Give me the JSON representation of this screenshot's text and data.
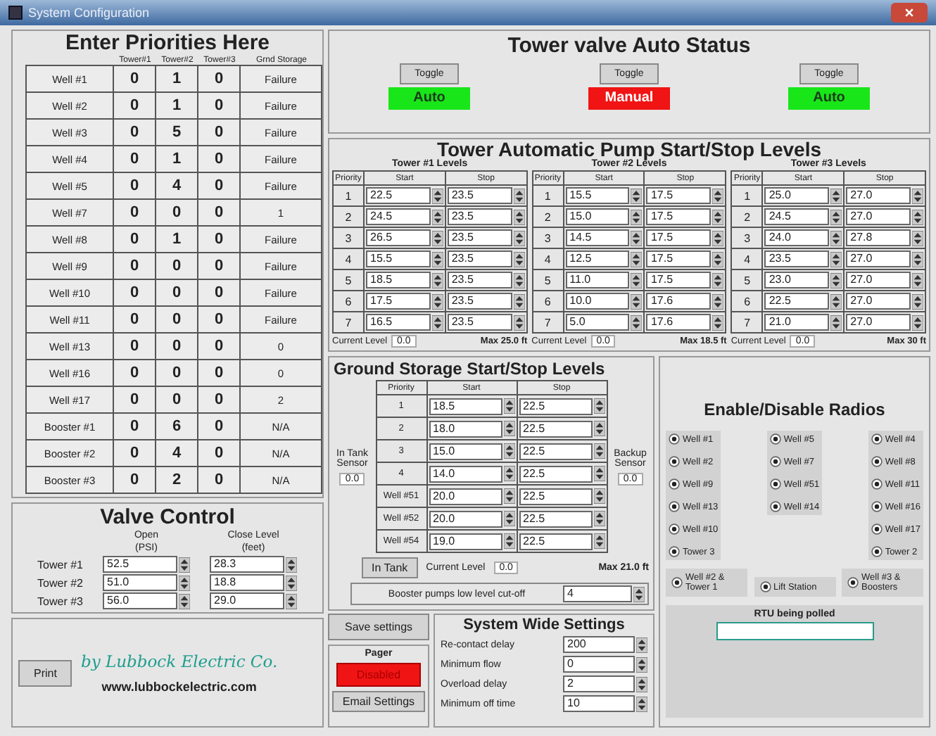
{
  "window": {
    "title": "System Configuration"
  },
  "priorities": {
    "title": "Enter Priorities Here",
    "columns": [
      "Tower#1",
      "Tower#2",
      "Tower#3",
      "Grnd Storage"
    ],
    "rows": [
      {
        "name": "Well #1",
        "values": [
          "0",
          "1",
          "0",
          "Failure"
        ]
      },
      {
        "name": "Well #2",
        "values": [
          "0",
          "1",
          "0",
          "Failure"
        ]
      },
      {
        "name": "Well #3",
        "values": [
          "0",
          "5",
          "0",
          "Failure"
        ]
      },
      {
        "name": "Well #4",
        "values": [
          "0",
          "1",
          "0",
          "Failure"
        ]
      },
      {
        "name": "Well #5",
        "values": [
          "0",
          "4",
          "0",
          "Failure"
        ]
      },
      {
        "name": "Well #7",
        "values": [
          "0",
          "0",
          "0",
          "1"
        ]
      },
      {
        "name": "Well #8",
        "values": [
          "0",
          "1",
          "0",
          "Failure"
        ]
      },
      {
        "name": "Well #9",
        "values": [
          "0",
          "0",
          "0",
          "Failure"
        ]
      },
      {
        "name": "Well #10",
        "values": [
          "0",
          "0",
          "0",
          "Failure"
        ]
      },
      {
        "name": "Well #11",
        "values": [
          "0",
          "0",
          "0",
          "Failure"
        ]
      },
      {
        "name": "Well #13",
        "values": [
          "0",
          "0",
          "0",
          "0"
        ]
      },
      {
        "name": "Well #16",
        "values": [
          "0",
          "0",
          "0",
          "0"
        ]
      },
      {
        "name": "Well #17",
        "values": [
          "0",
          "0",
          "0",
          "2"
        ]
      },
      {
        "name": "Booster #1",
        "values": [
          "0",
          "6",
          "0",
          "N/A"
        ]
      },
      {
        "name": "Booster #2",
        "values": [
          "0",
          "4",
          "0",
          "N/A"
        ]
      },
      {
        "name": "Booster #3",
        "values": [
          "0",
          "2",
          "0",
          "N/A"
        ]
      }
    ]
  },
  "valve_control": {
    "title": "Valve Control",
    "open_header": [
      "Open",
      "(PSI)"
    ],
    "close_header": [
      "Close Level",
      "(feet)"
    ],
    "rows": [
      {
        "name": "Tower #1",
        "open": "52.5",
        "close": "28.3"
      },
      {
        "name": "Tower #2",
        "open": "51.0",
        "close": "18.8"
      },
      {
        "name": "Tower #3",
        "open": "56.0",
        "close": "29.0"
      }
    ]
  },
  "footer": {
    "print_button": "Print",
    "logo": "by Lubbock Electric Co.",
    "website": "www.lubbockelectric.com"
  },
  "valve_status": {
    "title": "Tower valve Auto Status",
    "towers": [
      {
        "button": "Toggle",
        "mode": "Auto",
        "kind": "auto"
      },
      {
        "button": "Toggle",
        "mode": "Manual",
        "kind": "manual"
      },
      {
        "button": "Toggle",
        "mode": "Auto",
        "kind": "auto"
      }
    ]
  },
  "pump_levels": {
    "title": "Tower Automatic Pump Start/Stop Levels",
    "towers": [
      {
        "title": "Tower #1 Levels",
        "columns": [
          "Priority",
          "Start",
          "Stop"
        ],
        "current_label": "Current Level",
        "current": "0.0",
        "max": "Max 25.0 ft",
        "rows": [
          {
            "priority": "1",
            "start": "22.5",
            "stop": "23.5"
          },
          {
            "priority": "2",
            "start": "24.5",
            "stop": "23.5"
          },
          {
            "priority": "3",
            "start": "26.5",
            "stop": "23.5"
          },
          {
            "priority": "4",
            "start": "15.5",
            "stop": "23.5"
          },
          {
            "priority": "5",
            "start": "18.5",
            "stop": "23.5"
          },
          {
            "priority": "6",
            "start": "17.5",
            "stop": "23.5"
          },
          {
            "priority": "7",
            "start": "16.5",
            "stop": "23.5"
          }
        ]
      },
      {
        "title": "Tower #2 Levels",
        "columns": [
          "Priority",
          "Start",
          "Stop"
        ],
        "current_label": "Current Level",
        "current": "0.0",
        "max": "Max 18.5 ft",
        "rows": [
          {
            "priority": "1",
            "start": "15.5",
            "stop": "17.5"
          },
          {
            "priority": "2",
            "start": "15.0",
            "stop": "17.5"
          },
          {
            "priority": "3",
            "start": "14.5",
            "stop": "17.5"
          },
          {
            "priority": "4",
            "start": "12.5",
            "stop": "17.5"
          },
          {
            "priority": "5",
            "start": "11.0",
            "stop": "17.5"
          },
          {
            "priority": "6",
            "start": "10.0",
            "stop": "17.6"
          },
          {
            "priority": "7",
            "start": "5.0",
            "stop": "17.6"
          }
        ]
      },
      {
        "title": "Tower #3 Levels",
        "columns": [
          "Priority",
          "Start",
          "Stop"
        ],
        "current_label": "Current Level",
        "current": "0.0",
        "max": "Max 30 ft",
        "rows": [
          {
            "priority": "1",
            "start": "25.0",
            "stop": "27.0"
          },
          {
            "priority": "2",
            "start": "24.5",
            "stop": "27.0"
          },
          {
            "priority": "3",
            "start": "24.0",
            "stop": "27.8"
          },
          {
            "priority": "4",
            "start": "23.5",
            "stop": "27.0"
          },
          {
            "priority": "5",
            "start": "23.0",
            "stop": "27.0"
          },
          {
            "priority": "6",
            "start": "22.5",
            "stop": "27.0"
          },
          {
            "priority": "7",
            "start": "21.0",
            "stop": "27.0"
          }
        ]
      }
    ]
  },
  "ground_storage": {
    "title": "Ground Storage Start/Stop Levels",
    "columns": [
      "Priority",
      "Start",
      "Stop"
    ],
    "rows": [
      {
        "priority": "1",
        "start": "18.5",
        "stop": "22.5"
      },
      {
        "priority": "2",
        "start": "18.0",
        "stop": "22.5"
      },
      {
        "priority": "3",
        "start": "15.0",
        "stop": "22.5"
      },
      {
        "priority": "4",
        "start": "14.0",
        "stop": "22.5"
      },
      {
        "priority": "Well #51",
        "start": "20.0",
        "stop": "22.5"
      },
      {
        "priority": "Well #52",
        "start": "20.0",
        "stop": "22.5"
      },
      {
        "priority": "Well #54",
        "start": "19.0",
        "stop": "22.5"
      }
    ],
    "in_tank_sensor": {
      "label": "In Tank Sensor",
      "value": "0.0"
    },
    "backup_sensor": {
      "label": "Backup Sensor",
      "value": "0.0"
    },
    "in_tank_button": "In Tank",
    "current_label": "Current Level",
    "current": "0.0",
    "max": "Max 21.0 ft",
    "cutoff": {
      "label": "Booster pumps low level cut-off",
      "value": "4"
    }
  },
  "save_button": "Save settings",
  "pager": {
    "title": "Pager",
    "status": "Disabled",
    "enabled": false,
    "email_button": "Email Settings"
  },
  "system_settings": {
    "title": "System Wide Settings",
    "rows": [
      {
        "label": "Re-contact delay",
        "value": "200"
      },
      {
        "label": "Minimum flow",
        "value": "0"
      },
      {
        "label": "Overload delay",
        "value": "2"
      },
      {
        "label": "Minimum off time",
        "value": "10"
      }
    ]
  },
  "radios": {
    "title": "Enable/Disable Radios",
    "columns": [
      [
        {
          "label": "Well #1",
          "selected": true
        },
        {
          "label": "Well #2",
          "selected": true
        },
        {
          "label": "Well #9",
          "selected": true
        },
        {
          "label": "Well #13",
          "selected": true
        },
        {
          "label": "Well #10",
          "selected": true
        },
        {
          "label": "Tower 3",
          "selected": true
        }
      ],
      [
        {
          "label": "Well #5",
          "selected": true
        },
        {
          "label": "Well #7",
          "selected": true
        },
        {
          "label": "Well #51",
          "selected": true
        },
        {
          "label": "Well #14",
          "selected": true
        }
      ],
      [
        {
          "label": "Well #4",
          "selected": true
        },
        {
          "label": "Well #8",
          "selected": true
        },
        {
          "label": "Well #11",
          "selected": true
        },
        {
          "label": "Well #16",
          "selected": true
        },
        {
          "label": "Well #17",
          "selected": true
        },
        {
          "label": "Tower 2",
          "selected": true
        }
      ]
    ],
    "bottom": [
      {
        "label": "Well #2 & Tower 1",
        "selected": true
      },
      {
        "label": "Lift Station",
        "selected": true
      },
      {
        "label": "Well #3 & Boosters",
        "selected": true
      }
    ]
  },
  "rtu": {
    "label": "RTU being polled"
  }
}
